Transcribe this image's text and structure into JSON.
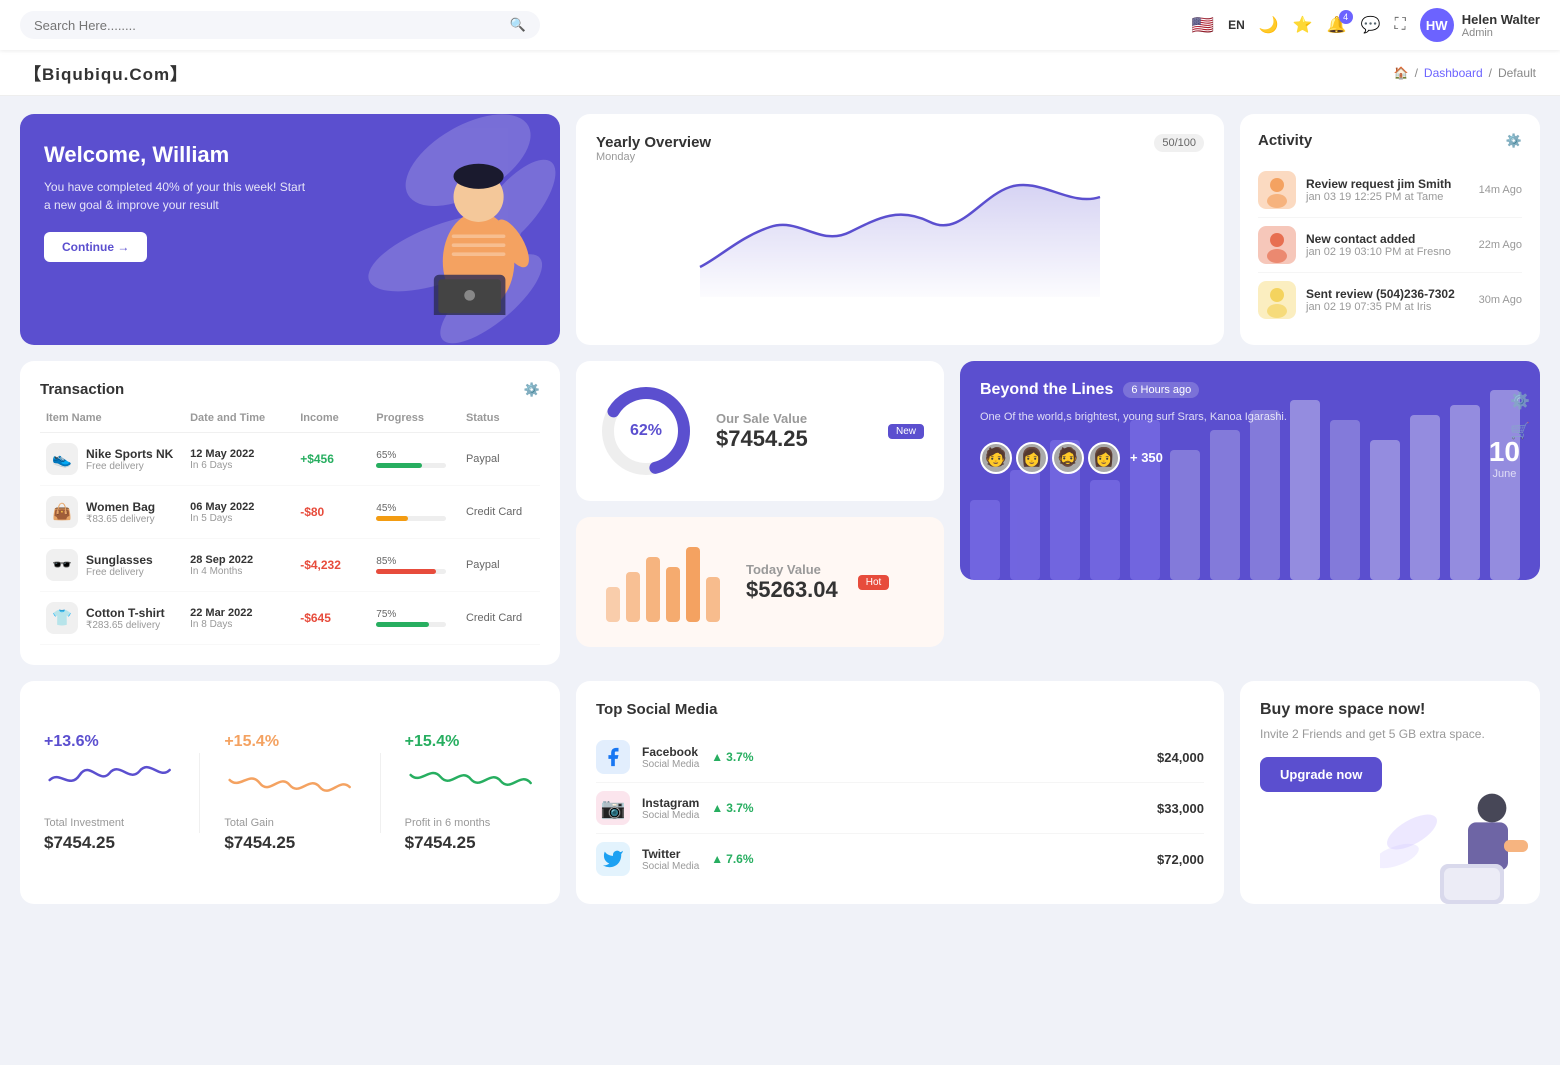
{
  "topnav": {
    "search_placeholder": "Search Here........",
    "lang": "EN",
    "notification_count": "4",
    "user": {
      "name": "Helen Walter",
      "role": "Admin",
      "initials": "HW"
    }
  },
  "breadcrumb": {
    "logo": "【Biqubiqu.Com】",
    "home": "Home",
    "dashboard": "Dashboard",
    "current": "Default"
  },
  "welcome": {
    "title": "Welcome, William",
    "subtitle": "You have completed 40% of your this week! Start a new goal & improve your result",
    "button": "Continue →"
  },
  "yearly": {
    "title": "Yearly Overview",
    "day": "Monday",
    "progress": "50/100"
  },
  "activity": {
    "title": "Activity",
    "items": [
      {
        "title": "Review request jim Smith",
        "sub": "jan 03 19 12:25 PM at Tame",
        "time": "14m Ago",
        "color": "#f4a261"
      },
      {
        "title": "New contact added",
        "sub": "jan 02 19 03:10 PM at Fresno",
        "time": "22m Ago",
        "color": "#e76f51"
      },
      {
        "title": "Sent review (504)236-7302",
        "sub": "jan 02 19 07:35 PM at Iris",
        "time": "30m Ago",
        "color": "#f4d35e"
      }
    ]
  },
  "transaction": {
    "title": "Transaction",
    "columns": [
      "Item Name",
      "Date and Time",
      "Income",
      "Progress",
      "Status"
    ],
    "rows": [
      {
        "name": "Nike Sports NK",
        "sub": "Free delivery",
        "date": "12 May 2022",
        "days": "In 6 Days",
        "income": "+$456",
        "positive": true,
        "progress": 65,
        "progress_color": "#27ae60",
        "status": "Paypal",
        "icon": "👟"
      },
      {
        "name": "Women Bag",
        "sub": "₹83.65 delivery",
        "date": "06 May 2022",
        "days": "In 5 Days",
        "income": "-$80",
        "positive": false,
        "progress": 45,
        "progress_color": "#f39c12",
        "status": "Credit Card",
        "icon": "👜"
      },
      {
        "name": "Sunglasses",
        "sub": "Free delivery",
        "date": "28 Sep 2022",
        "days": "In 4 Months",
        "income": "-$4,232",
        "positive": false,
        "progress": 85,
        "progress_color": "#e74c3c",
        "status": "Paypal",
        "icon": "🕶️"
      },
      {
        "name": "Cotton T-shirt",
        "sub": "₹283.65 delivery",
        "date": "22 Mar 2022",
        "days": "In 8 Days",
        "income": "-$645",
        "positive": false,
        "progress": 75,
        "progress_color": "#27ae60",
        "status": "Credit Card",
        "icon": "👕"
      }
    ]
  },
  "sale": {
    "badge": "New",
    "percent": "62%",
    "label": "Our Sale Value",
    "value": "$7454.25",
    "donut_value": 62
  },
  "today": {
    "badge": "Hot",
    "label": "Today Value",
    "value": "$5263.04"
  },
  "beyond": {
    "title": "Beyond the Lines",
    "time": "6 Hours ago",
    "desc": "One Of the world,s brightest, young surf Srars, Kanoa Igarashi.",
    "plus": "+ 350",
    "date_num": "10",
    "date_month": "June"
  },
  "stats": [
    {
      "pct": "+13.6%",
      "color": "#5b4fcf",
      "label": "Total Investment",
      "value": "$7454.25"
    },
    {
      "pct": "+15.4%",
      "color": "#f4a261",
      "label": "Total Gain",
      "value": "$7454.25"
    },
    {
      "pct": "+15.4%",
      "color": "#27ae60",
      "label": "Profit in 6 months",
      "value": "$7454.25"
    }
  ],
  "social": {
    "title": "Top Social Media",
    "items": [
      {
        "name": "Facebook",
        "sub": "Social Media",
        "pct": "3.7%",
        "amount": "$24,000",
        "color": "#1877f2",
        "icon": "f"
      },
      {
        "name": "Instagram",
        "sub": "Social Media",
        "pct": "3.7%",
        "amount": "$33,000",
        "color": "#e1306c",
        "icon": "📷"
      },
      {
        "name": "Twitter",
        "sub": "Social Media",
        "pct": "7.6%",
        "amount": "$72,000",
        "color": "#1da1f2",
        "icon": "🐦"
      }
    ]
  },
  "space": {
    "title": "Buy more space now!",
    "desc": "Invite 2 Friends and get 5 GB extra space.",
    "button": "Upgrade now"
  }
}
